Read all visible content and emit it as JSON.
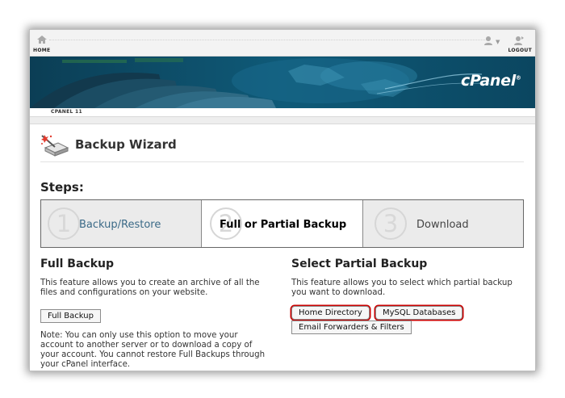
{
  "topbar": {
    "home_label": "HOME",
    "logout_label": "LOGOUT",
    "icons": [
      "home-icon",
      "user-icon",
      "chevron-down-icon",
      "logout-icon"
    ]
  },
  "banner": {
    "brand": "cPanel"
  },
  "strip": {
    "version_label": "CPANEL 11"
  },
  "page": {
    "title": "Backup Wizard",
    "icon": "backup-wizard-icon"
  },
  "steps": {
    "heading": "Steps:",
    "items": [
      {
        "number": "1",
        "label": "Backup/Restore"
      },
      {
        "number": "2",
        "label": "Full or Partial Backup"
      },
      {
        "number": "3",
        "label": "Download"
      }
    ],
    "active_index": 1
  },
  "full_backup": {
    "title": "Full Backup",
    "description": "This feature allows you to create an archive of all the files and configurations on your website.",
    "button_label": "Full Backup",
    "note": "Note: You can only use this option to move your account to another server or to download a copy of your account. You cannot restore Full Backups through your cPanel interface."
  },
  "partial_backup": {
    "title": "Select Partial Backup",
    "description": "This feature allows you to select which partial backup you want to download.",
    "buttons": [
      "Home Directory",
      "MySQL Databases",
      "Email Forwarders & Filters"
    ]
  },
  "colors": {
    "banner": "#0c4a63",
    "highlight": "#cc0000",
    "step_link": "#3b6a87"
  }
}
